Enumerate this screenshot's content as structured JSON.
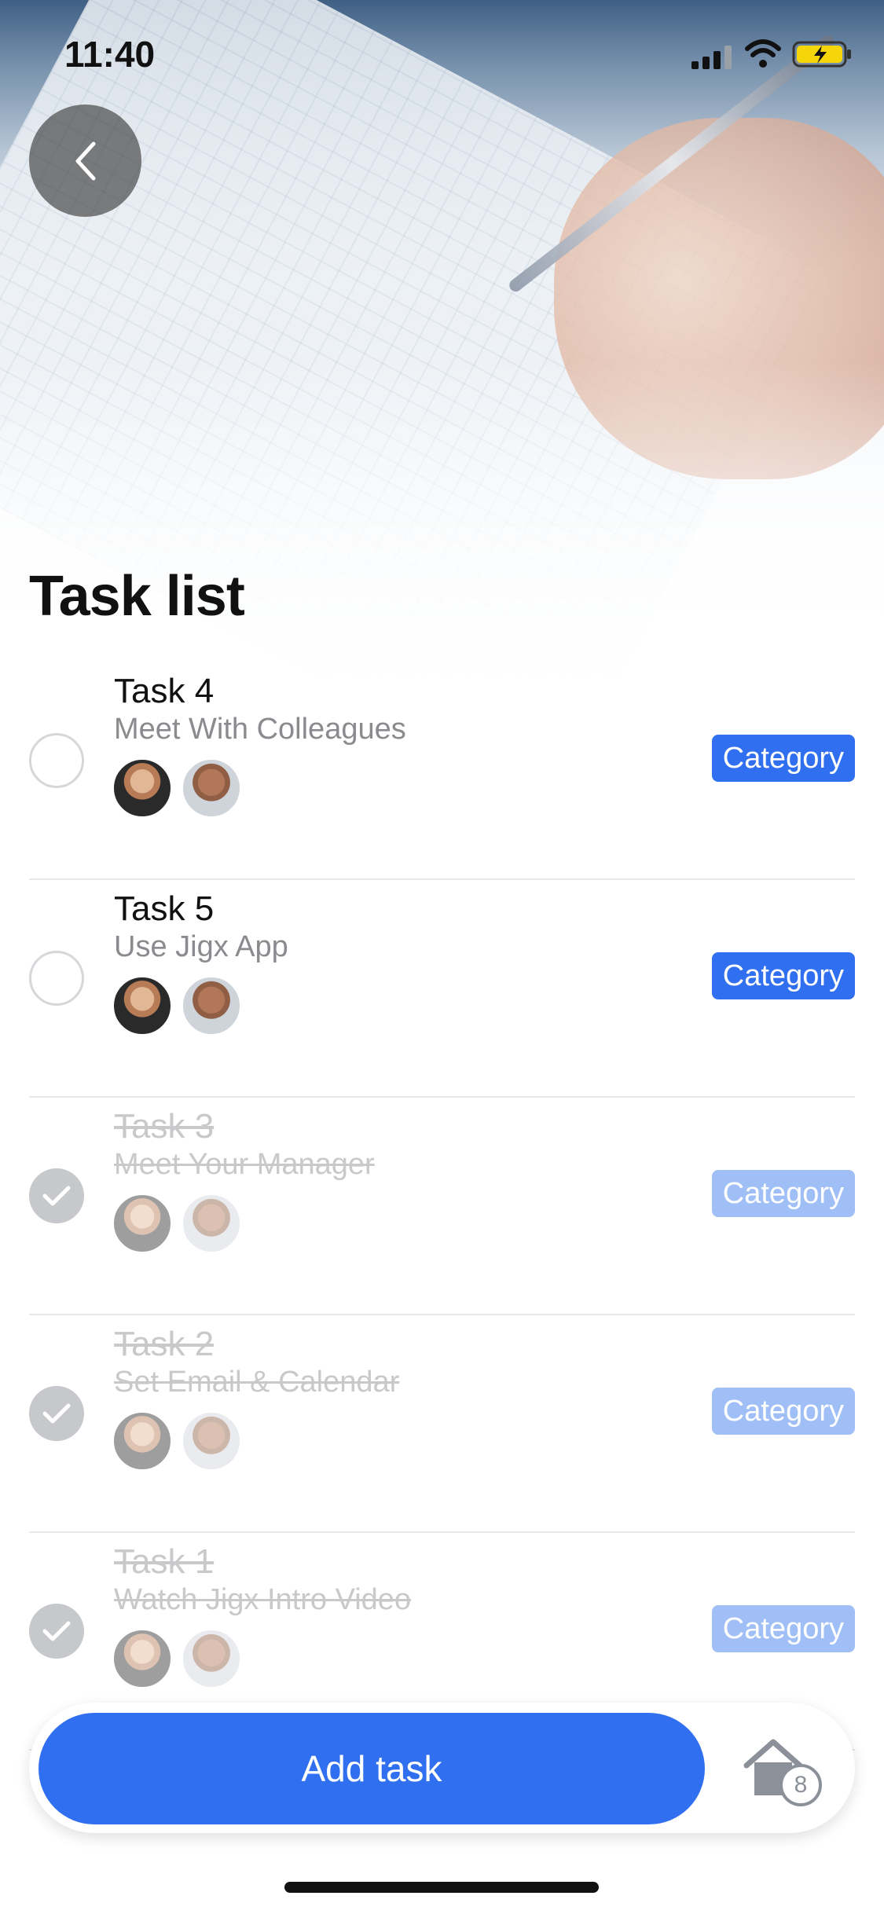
{
  "status_bar": {
    "time": "11:40"
  },
  "header": {
    "title": "Task list"
  },
  "colors": {
    "accent": "#2f6ff0",
    "accent_faded": "#9fbff6",
    "check_done": "#c7c8cc"
  },
  "tasks": [
    {
      "name": "Task 4",
      "subtitle": "Meet With Colleagues",
      "category": "Category",
      "done": false
    },
    {
      "name": "Task 5",
      "subtitle": "Use Jigx App",
      "category": "Category",
      "done": false
    },
    {
      "name": "Task 3",
      "subtitle": "Meet Your Manager",
      "category": "Category",
      "done": true
    },
    {
      "name": "Task 2",
      "subtitle": "Set Email & Calendar",
      "category": "Category",
      "done": true
    },
    {
      "name": "Task 1",
      "subtitle": "Watch Jigx Intro Video",
      "category": "Category",
      "done": true
    }
  ],
  "bottom": {
    "add_task_label": "Add task",
    "home_badge": "8"
  },
  "icons": [
    "back-chevron-icon",
    "signal-icon",
    "wifi-icon",
    "battery-charging-icon",
    "check-icon",
    "home-icon"
  ]
}
